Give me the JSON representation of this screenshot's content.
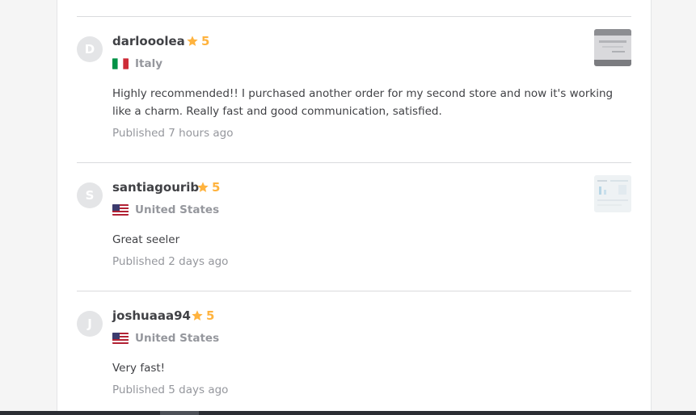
{
  "reviews": [
    {
      "initial": "D",
      "username": "darlooolea",
      "rating": "5",
      "country": "Italy",
      "flag": "italy-flag-icon",
      "text": "Highly recommended!! I purchased another order for my second store and now it's working like a charm. Really fast and good communication, satisfied.",
      "published": "Published 7 hours ago",
      "has_attachment": true
    },
    {
      "initial": "S",
      "username": "santiagourib",
      "rating": "5",
      "country": "United States",
      "flag": "united-states-flag-icon",
      "text": "Great seeler",
      "published": "Published 2 days ago",
      "has_attachment": true
    },
    {
      "initial": "J",
      "username": "joshuaaa94",
      "rating": "5",
      "country": "United States",
      "flag": "united-states-flag-icon",
      "text": "Very fast!",
      "published": "Published 5 days ago",
      "has_attachment": false
    }
  ],
  "colors": {
    "star": "#ffb33e",
    "text": "#404145",
    "muted": "#95979d",
    "avatar_bg": "#e4e5e7",
    "divider": "#dadbdd"
  }
}
